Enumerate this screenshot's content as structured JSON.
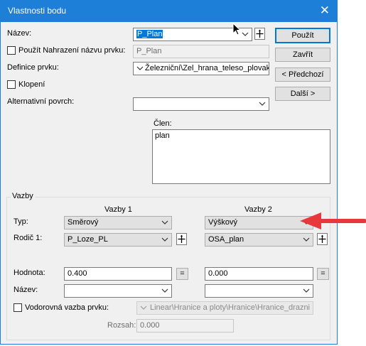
{
  "window": {
    "title": "Vlastnosti bodu",
    "close_glyph": "✕"
  },
  "nazev": {
    "label": "Název:",
    "value": "P_Plan"
  },
  "replace": {
    "label": "Použít Nahrazení názvu prvku:",
    "value": "P_Plan"
  },
  "definice": {
    "label": "Definice prvku:",
    "value": "Železniční\\Zel_hrana_teleso_plovak"
  },
  "klopeni": {
    "label": "Klopení"
  },
  "alt_povrch": {
    "label": "Alternativní povrch:",
    "value": ""
  },
  "clen": {
    "label": "Člen:",
    "value": "plan"
  },
  "buttons": {
    "use": "Použít",
    "close": "Zavřít",
    "prev": "< Předchozí",
    "next": "Další >"
  },
  "vazby": {
    "group_label": "Vazby",
    "col1": "Vazby 1",
    "col2": "Vazby 2",
    "typ_label": "Typ:",
    "typ1": "Směrový",
    "typ2": "Výškový",
    "rodic_label": "Rodič 1:",
    "rodic1": "P_Loze_PL",
    "rodic2": "OSA_plan",
    "hodnota_label": "Hodnota:",
    "hodnota1": "0.400",
    "hodnota2": "0.000",
    "eq": "=",
    "nazev_label": "Název:",
    "nazev1": "",
    "nazev2": "",
    "vodorovna_label": "Vodorovná vazba prvku:",
    "vodorovna_value": "Linear\\Hranice a ploty\\Hranice\\Hranice_drazni",
    "rozsah_label": "Rozsah:",
    "rozsah_value": "0.000"
  },
  "colors": {
    "titlebar": "#1e7fd8",
    "annotation_arrow": "#e8383d",
    "selection": "#0078d7"
  },
  "icons": {
    "close": "close-icon",
    "dropdown": "chevron-down-icon",
    "pick": "pick-element-icon",
    "cursor": "mouse-cursor-icon",
    "arrow": "red-arrow-annotation"
  }
}
